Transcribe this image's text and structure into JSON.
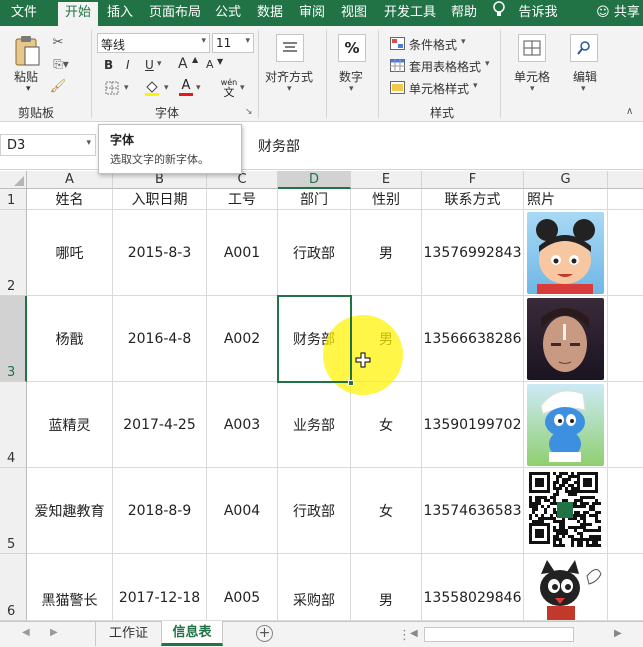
{
  "ribbon_tabs": [
    "文件",
    "开始",
    "插入",
    "页面布局",
    "公式",
    "数据",
    "审阅",
    "视图",
    "开发工具",
    "帮助"
  ],
  "tell_me": "告诉我",
  "share": "共享",
  "clipboard": {
    "paste": "粘贴",
    "group": "剪贴板"
  },
  "font": {
    "name": "等线",
    "size": "11",
    "bold": "B",
    "italic": "I",
    "underline": "U",
    "grow": "A",
    "shrink": "A",
    "wen": "wén",
    "wen_char": "文",
    "group": "字体"
  },
  "alignment": {
    "label": "对齐方式"
  },
  "number": {
    "label": "数字",
    "symbol": "%"
  },
  "styles": {
    "conditional": "条件格式",
    "table": "套用表格格式",
    "cell": "单元格样式",
    "group": "样式"
  },
  "cells": {
    "label": "单元格"
  },
  "editing": {
    "label": "编辑"
  },
  "tooltip": {
    "title": "字体",
    "desc": "选取文字的新字体。"
  },
  "name_box": "D3",
  "formula_value": "财务部",
  "columns": [
    "A",
    "B",
    "C",
    "D",
    "E",
    "F",
    "G"
  ],
  "headers": [
    "姓名",
    "入职日期",
    "工号",
    "部门",
    "性别",
    "联系方式",
    "照片"
  ],
  "rows": [
    {
      "num": "2",
      "name": "哪吒",
      "date": "2015-8-3",
      "id": "A001",
      "dept": "行政部",
      "gender": "男",
      "phone": "13576992843"
    },
    {
      "num": "3",
      "name": "杨戬",
      "date": "2016-4-8",
      "id": "A002",
      "dept": "财务部",
      "gender": "男",
      "phone": "13566638286"
    },
    {
      "num": "4",
      "name": "蓝精灵",
      "date": "2017-4-25",
      "id": "A003",
      "dept": "业务部",
      "gender": "女",
      "phone": "13590199702"
    },
    {
      "num": "5",
      "name": "爱知趣教育",
      "date": "2018-8-9",
      "id": "A004",
      "dept": "行政部",
      "gender": "女",
      "phone": "13574636583"
    },
    {
      "num": "6",
      "name": "黑猫警长",
      "date": "2017-12-18",
      "id": "A005",
      "dept": "采购部",
      "gender": "男",
      "phone": "13558029846"
    }
  ],
  "header_row_num": "1",
  "sheet_tabs": [
    "工作证",
    "信息表"
  ],
  "active_sheet": "信息表",
  "colors": {
    "accent": "#217346",
    "highlight": "#fff200"
  }
}
